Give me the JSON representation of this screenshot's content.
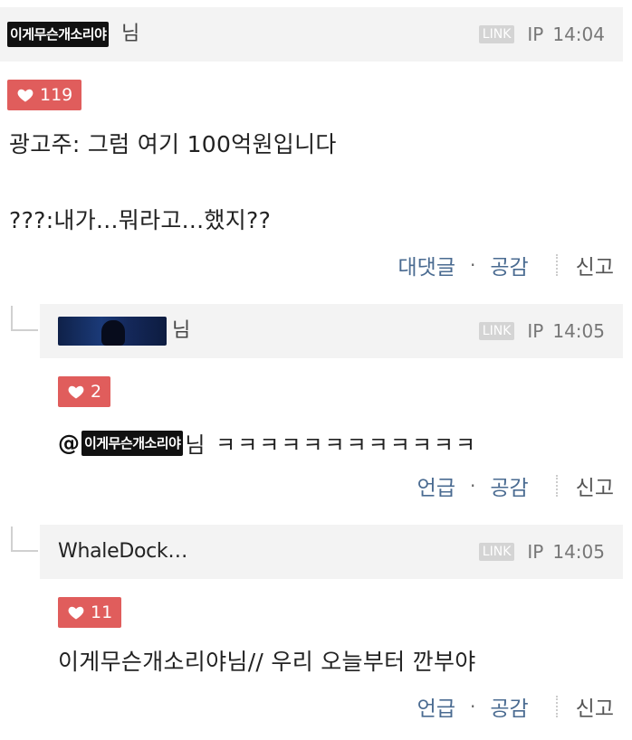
{
  "comments": [
    {
      "nickname": "이게무슨개소리야",
      "suffix": "님",
      "link_label": "LINK",
      "ip_label": "IP",
      "time": "14:04",
      "likes": "119",
      "body_line1": "광고주: 그럼 여기 100억원입니다",
      "body_line2": "???:내가...뭐라고...했지??",
      "action_reply": "대댓글",
      "action_sep": "·",
      "action_like": "공감",
      "action_report": "신고"
    },
    {
      "nickname": "",
      "suffix": "님",
      "link_label": "LINK",
      "ip_label": "IP",
      "time": "14:05",
      "likes": "2",
      "mention_at": "@",
      "mention_nick": "이게무슨개소리야",
      "mention_rest": "님 ㅋㅋㅋㅋㅋㅋㅋㅋㅋㅋㅋㅋ",
      "action_reply": "언급",
      "action_sep": "·",
      "action_like": "공감",
      "action_report": "신고"
    },
    {
      "nickname": "WhaleDock…",
      "link_label": "LINK",
      "ip_label": "IP",
      "time": "14:05",
      "likes": "11",
      "body": "이게무슨개소리야님// 우리 오늘부터 깐부야",
      "action_reply": "언급",
      "action_sep": "·",
      "action_like": "공감",
      "action_report": "신고"
    }
  ],
  "colors": {
    "like_badge": "#e05d5c",
    "action_link": "#4a6b91",
    "header_bg": "#f3f3f3",
    "link_badge": "#d4d4d4"
  },
  "icons": [
    "heart-icon"
  ]
}
